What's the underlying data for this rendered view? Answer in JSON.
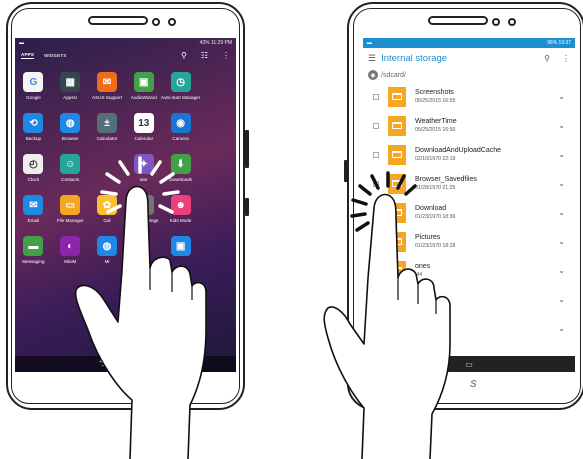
{
  "left_tablet": {
    "status_right": "43% 11:29 PM",
    "tabs": [
      {
        "label": "APPS"
      },
      {
        "label": "WIDGETS"
      }
    ],
    "actions": {
      "search": "⚲",
      "grid": "☷",
      "menu": "⋮"
    },
    "apps": [
      {
        "label": "Google",
        "icon": "G",
        "color": "#f4f4f4",
        "fg": "#4285f4"
      },
      {
        "label": "AppsU",
        "icon": "▦",
        "color": "#37474f",
        "fg": "#ffffff"
      },
      {
        "label": "ASUS Support",
        "icon": "✉",
        "color": "#ef6c1a",
        "fg": "#ffffff"
      },
      {
        "label": "AudioWizard",
        "icon": "▣",
        "color": "#43a047",
        "fg": "#ffffff"
      },
      {
        "label": "Auto-start Manager",
        "icon": "◷",
        "color": "#26a69a",
        "fg": "#ffffff"
      },
      {
        "label": "",
        "icon": "",
        "color": "transparent",
        "fg": "#ffffff"
      },
      {
        "label": "Backup",
        "icon": "⟲",
        "color": "#1e88e5",
        "fg": "#ffffff"
      },
      {
        "label": "Browser",
        "icon": "◍",
        "color": "#1e88e5",
        "fg": "#ffffff"
      },
      {
        "label": "Calculator",
        "icon": "±",
        "color": "#546e7a",
        "fg": "#ffffff"
      },
      {
        "label": "Calendar",
        "icon": "13",
        "color": "#ffffff",
        "fg": "#333333"
      },
      {
        "label": "Camera",
        "icon": "◉",
        "color": "#1976d2",
        "fg": "#ffffff"
      },
      {
        "label": "",
        "icon": "",
        "color": "transparent",
        "fg": "#ffffff"
      },
      {
        "label": "Clock",
        "icon": "◴",
        "color": "#eeeeee",
        "fg": "#333333"
      },
      {
        "label": "Contacts",
        "icon": "☺",
        "color": "#26a69a",
        "fg": "#ffffff"
      },
      {
        "label": "",
        "icon": "",
        "color": "transparent",
        "fg": "#ffffff"
      },
      {
        "label": "ator",
        "icon": "✦",
        "color": "#7e57c2",
        "fg": "#ffffff"
      },
      {
        "label": "Downloads",
        "icon": "⬇",
        "color": "#43a047",
        "fg": "#ffffff"
      },
      {
        "label": "",
        "icon": "",
        "color": "transparent",
        "fg": "#ffffff"
      },
      {
        "label": "Email",
        "icon": "✉",
        "color": "#1e88e5",
        "fg": "#ffffff"
      },
      {
        "label": "File Manager",
        "icon": "▭",
        "color": "#f5a623",
        "fg": "#ffffff"
      },
      {
        "label": "Gal",
        "icon": "✿",
        "color": "#fbc02d",
        "fg": "#ffffff"
      },
      {
        "label": "oogle Settings",
        "icon": "⚙",
        "color": "#757575",
        "fg": "#ffffff"
      },
      {
        "label": "Kids Mode",
        "icon": "☻",
        "color": "#ec407a",
        "fg": "#ffffff"
      },
      {
        "label": "",
        "icon": "",
        "color": "transparent",
        "fg": "#ffffff"
      },
      {
        "label": "Messaging",
        "icon": "▬",
        "color": "#43a047",
        "fg": "#ffffff"
      },
      {
        "label": "MiniM",
        "icon": "◐",
        "color": "#8e24aa",
        "fg": "#ffffff"
      },
      {
        "label": "Mi",
        "icon": "◍",
        "color": "#1e88e5",
        "fg": "#ffffff"
      },
      {
        "label": "",
        "icon": "",
        "color": "transparent",
        "fg": "#ffffff"
      },
      {
        "label": "",
        "icon": "▣",
        "color": "#1e88e5",
        "fg": "#ffffff"
      },
      {
        "label": "",
        "icon": "",
        "color": "transparent",
        "fg": "#ffffff"
      }
    ],
    "navbar": {
      "back": "⮌",
      "home": "⌂"
    }
  },
  "right_tablet": {
    "status_right": "96% 19:37",
    "title": "Internal storage",
    "path": "/sdcard/",
    "actions": {
      "search": "⚲",
      "menu": "⋮"
    },
    "folders": [
      {
        "name": "Screenshots",
        "date": "05/25/2015   16:55"
      },
      {
        "name": "WeatherTime",
        "date": "05/25/2015   16:50"
      },
      {
        "name": "DownloadAndUploadCache",
        "date": "02/10/1970   22:19"
      },
      {
        "name": "Browser_Savedfiles",
        "date": "01/28/1970   21:25"
      },
      {
        "name": "Download",
        "date": "01/23/1970   18:36"
      },
      {
        "name": "Pictures",
        "date": "01/23/1970   18:28"
      },
      {
        "name": "ones",
        "date": ":44"
      },
      {
        "name": "",
        "date": ""
      },
      {
        "name": "",
        "date": ""
      }
    ],
    "chevron": "⌄",
    "navbar": {
      "recent": "▭"
    },
    "brand": "S"
  }
}
